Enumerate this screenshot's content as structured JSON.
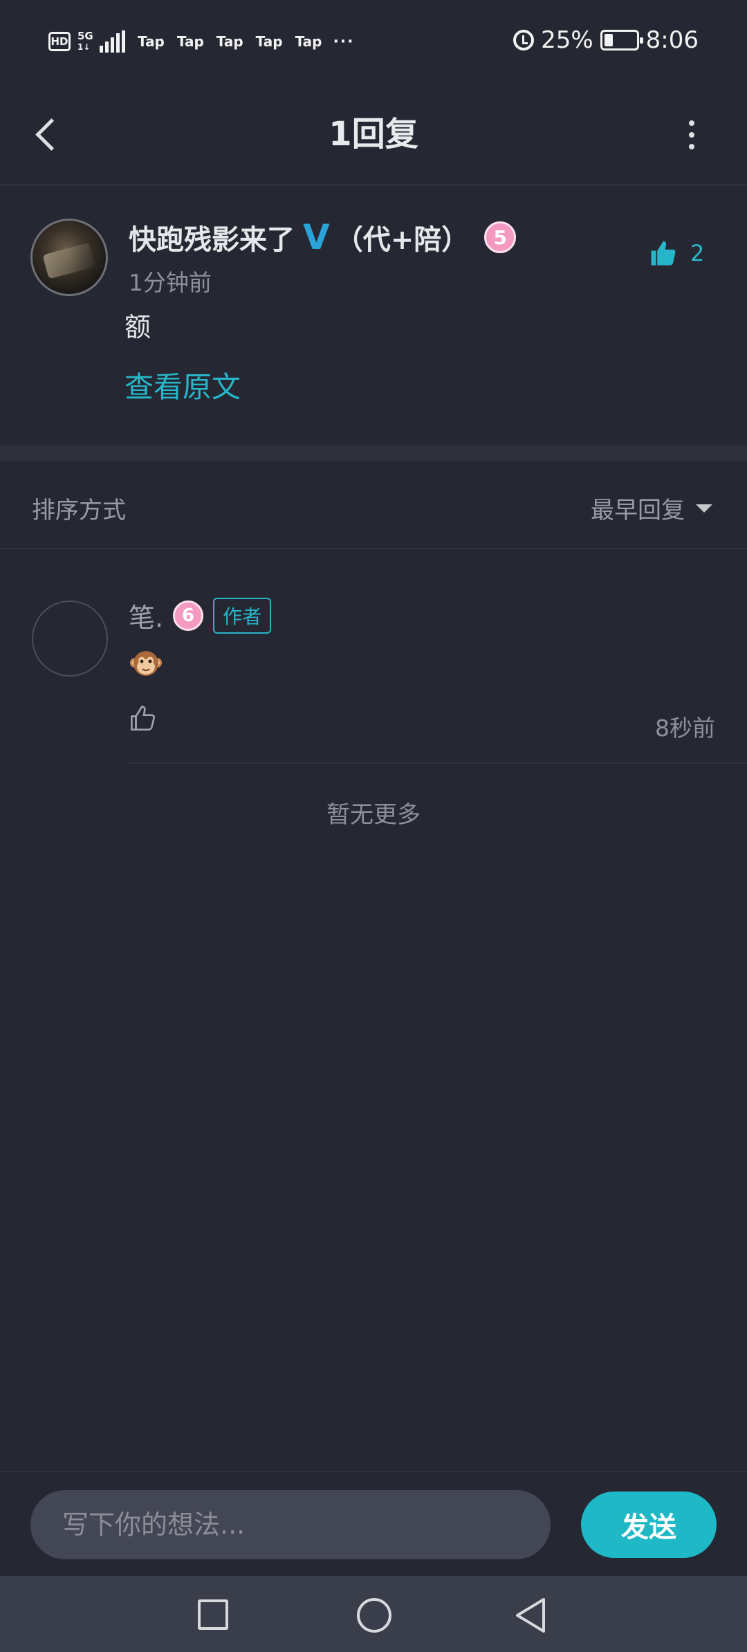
{
  "status_bar": {
    "hd": "HD",
    "network": "5G",
    "network_sub": "1↓",
    "notifications": [
      "Tap",
      "Tap",
      "Tap",
      "Tap",
      "Tap"
    ],
    "more": "···",
    "battery": "25%",
    "battery_level": 0.25,
    "time": "8:06"
  },
  "header": {
    "title": "1回复"
  },
  "main_comment": {
    "author": "快跑残影来了",
    "verified_mark": "V",
    "author_suffix": "（代+陪）",
    "level": "5",
    "time": "1分钟前",
    "content": "额",
    "view_original": "查看原文",
    "likes": "2"
  },
  "sort": {
    "label": "排序方式",
    "value": "最早回复"
  },
  "reply": {
    "author": "笔.",
    "level": "6",
    "badge": "作者",
    "time": "8秒前"
  },
  "list_end": "暂无更多",
  "input_bar": {
    "placeholder": "写下你的想法...",
    "send": "发送"
  },
  "colors": {
    "background": "#252732",
    "accent": "#27b6c9",
    "send_button": "#1fb8c6",
    "level_badge": "#f49ac1",
    "verified": "#2aa3d8"
  }
}
